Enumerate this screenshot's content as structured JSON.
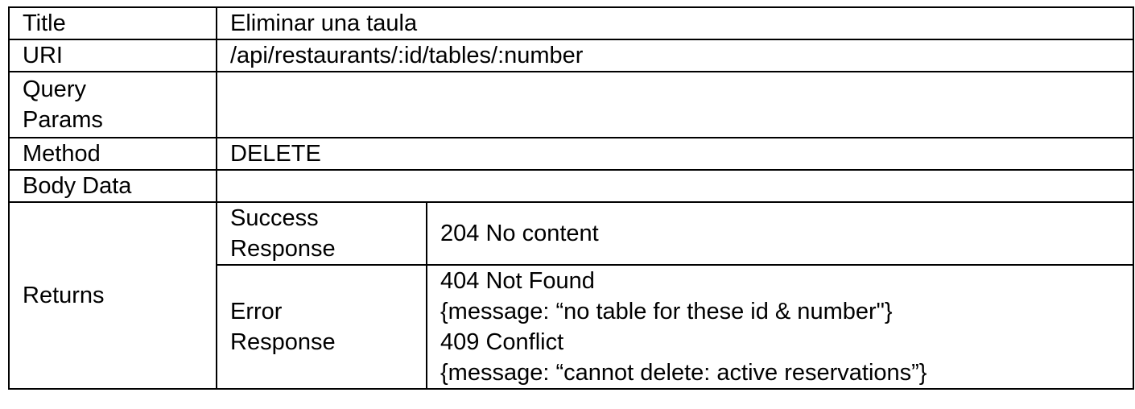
{
  "rows": {
    "title": {
      "label": "Title",
      "value": "Eliminar una taula"
    },
    "uri": {
      "label": "URI",
      "value": "/api/restaurants/:id/tables/:number"
    },
    "query_params": {
      "label_line1": "Query",
      "label_line2": "Params",
      "value": ""
    },
    "method": {
      "label": "Method",
      "value": "DELETE"
    },
    "body_data": {
      "label": "Body Data",
      "value": ""
    },
    "returns": {
      "label": "Returns",
      "success": {
        "label_line1": "Success",
        "label_line2": "Response",
        "value": "204 No content"
      },
      "error": {
        "label_line1": "Error",
        "label_line2": "Response",
        "lines": [
          "404 Not Found",
          "{message: “no table for these id & number\"}",
          "409 Conflict",
          "{message: “cannot delete: active reservations”}"
        ]
      }
    }
  }
}
